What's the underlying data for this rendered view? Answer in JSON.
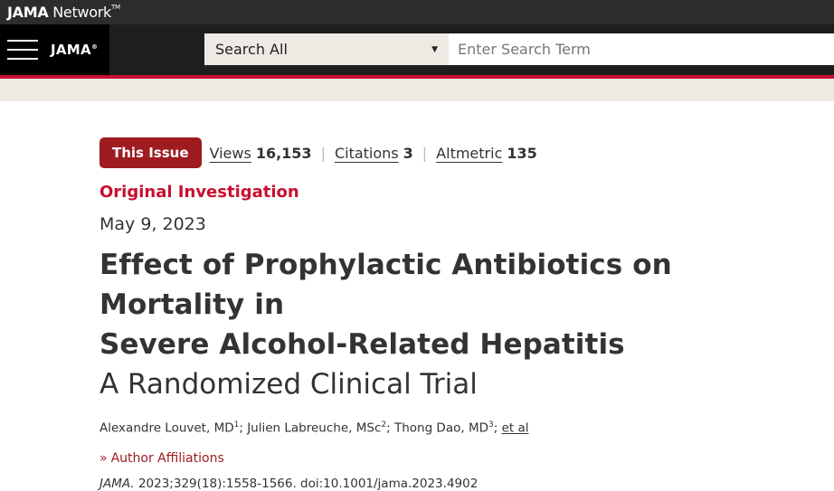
{
  "topbar": {
    "network_brand": "JAMA",
    "network_word": "Network",
    "tm": "TM"
  },
  "header": {
    "journal_logo": "JAMA",
    "registered": "®",
    "search_scope": "Search All",
    "search_placeholder": "Enter Search Term"
  },
  "article": {
    "this_issue": "This Issue",
    "metrics": [
      {
        "label": "Views",
        "value": "16,153"
      },
      {
        "label": "Citations",
        "value": "3"
      },
      {
        "label": "Altmetric",
        "value": "135"
      }
    ],
    "type": "Original Investigation",
    "date": "May 9, 2023",
    "title_line1": "Effect of Prophylactic Antibiotics on Mortality in",
    "title_line2": "Severe Alcohol-Related Hepatitis",
    "subtitle": "A Randomized Clinical Trial",
    "authors": [
      {
        "name": "Alexandre Louvet, MD",
        "sup": "1"
      },
      {
        "name": "Julien Labreuche, MSc",
        "sup": "2"
      },
      {
        "name": "Thong Dao, MD",
        "sup": "3"
      }
    ],
    "et_al": "et al",
    "affiliations_label": "Author Affiliations",
    "journal_abbrev": "JAMA.",
    "citation_ref": "2023;329(18):1558-1566. doi:10.1001/jama.2023.4902"
  }
}
